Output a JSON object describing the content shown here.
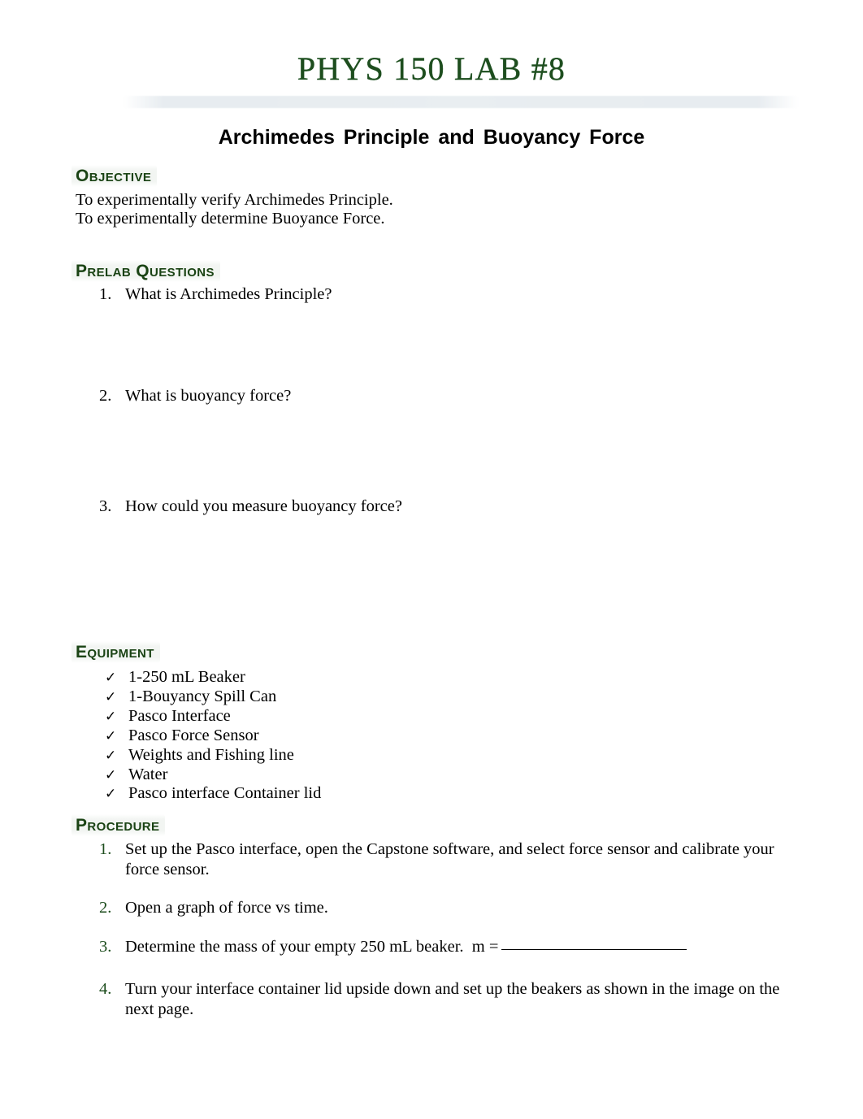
{
  "document": {
    "title": "PHYS 150 LAB #8",
    "subtitle": "Archimedes Principle and Buoyancy Force",
    "title_color": "#1e4d1e",
    "heading_color": "#1a4314"
  },
  "objective": {
    "heading": "Objective",
    "lines": [
      "To experimentally verify Archimedes Principle.",
      "To experimentally determine Buoyance Force."
    ]
  },
  "prelab": {
    "heading": "Prelab Questions",
    "questions": [
      {
        "number": "1.",
        "text": "What is Archimedes Principle?"
      },
      {
        "number": "2.",
        "text": "What is buoyancy force?"
      },
      {
        "number": "3.",
        "text": "How could you measure buoyancy force?"
      }
    ]
  },
  "equipment": {
    "heading": "Equipment",
    "bullet_glyph": "✓",
    "items": [
      "1-250 mL Beaker",
      "1-Bouyancy Spill Can",
      "Pasco Interface",
      "Pasco Force Sensor",
      "Weights and Fishing line",
      "Water",
      "Pasco interface Container lid"
    ]
  },
  "procedure": {
    "heading": "Procedure",
    "marker_color": "#1d4d1d",
    "steps": [
      {
        "number": "1.",
        "text": "Set up the Pasco interface, open the Capstone software, and select force sensor and calibrate your force sensor."
      },
      {
        "number": "2.",
        "text": "Open a graph of force vs time."
      },
      {
        "number": "3.",
        "text": "Determine the mass of your empty 250 mL beaker.",
        "field_label": "m =",
        "field_value": ""
      },
      {
        "number": "4.",
        "text": "Turn your interface container lid upside down and set up the beakers as shown in the image on the next page."
      }
    ]
  }
}
